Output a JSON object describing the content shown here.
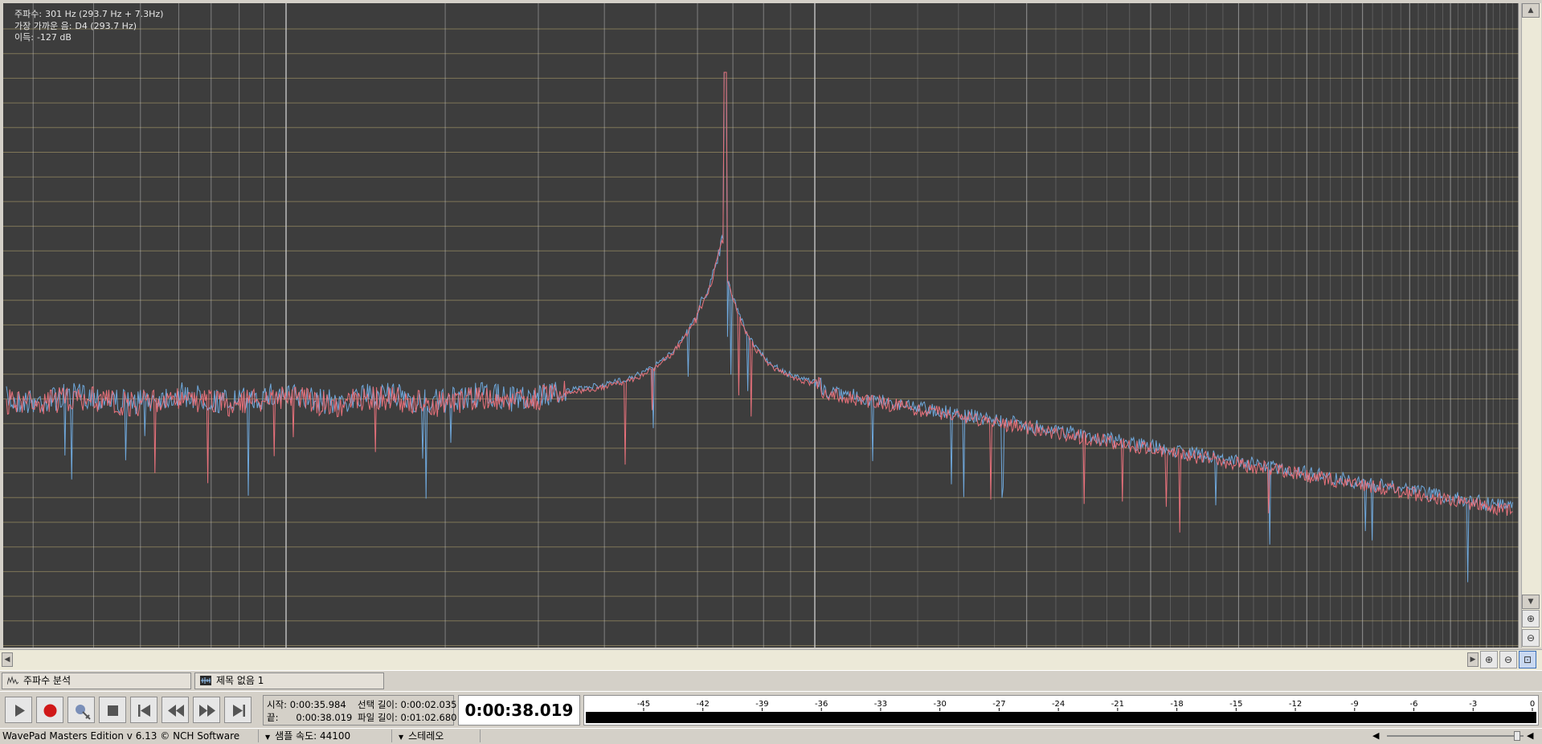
{
  "info": {
    "frequency_label": "주파수:",
    "frequency_value": "301 Hz (293.7 Hz + 7.3Hz)",
    "note_label": "가장 가까운 음:",
    "note_value": "D4 (293.7 Hz)",
    "gain_label": "이득:",
    "gain_value": "-127 dB"
  },
  "tabs": [
    {
      "label": "주파수 분석"
    },
    {
      "label": "제목 없음 1"
    }
  ],
  "time_panel": {
    "start_label": "시작:",
    "start_value": "0:00:35.984",
    "end_label": "끝:",
    "end_value": "0:00:38.019",
    "selection_label": "선택 길이:",
    "selection_value": "0:00:02.035",
    "file_label": "파일 길이:",
    "file_value": "0:01:02.680"
  },
  "current_time": "0:00:38.019",
  "meter": {
    "ticks": [
      "-45",
      "-42",
      "-39",
      "-36",
      "-33",
      "-30",
      "-27",
      "-24",
      "-21",
      "-18",
      "-15",
      "-12",
      "-9",
      "-6",
      "-3",
      "0"
    ]
  },
  "status": {
    "app": "WavePad Masters Edition v 6.13 © NCH Software",
    "sample_rate": "샘플 속도: 44100",
    "channels": "스테레오"
  },
  "transport_icons": [
    "play-icon",
    "record-icon",
    "record-options-icon",
    "stop-icon",
    "skip-start-icon",
    "rewind-icon",
    "fast-forward-icon",
    "skip-end-icon"
  ],
  "colors": {
    "plot_bg": "#3d3d3d",
    "grid_horizontal": "#b6a570",
    "grid_vertical": "#d0d0d0",
    "series_left": "#e8717b",
    "series_right": "#6fa8dc",
    "record": "#d01818"
  }
}
